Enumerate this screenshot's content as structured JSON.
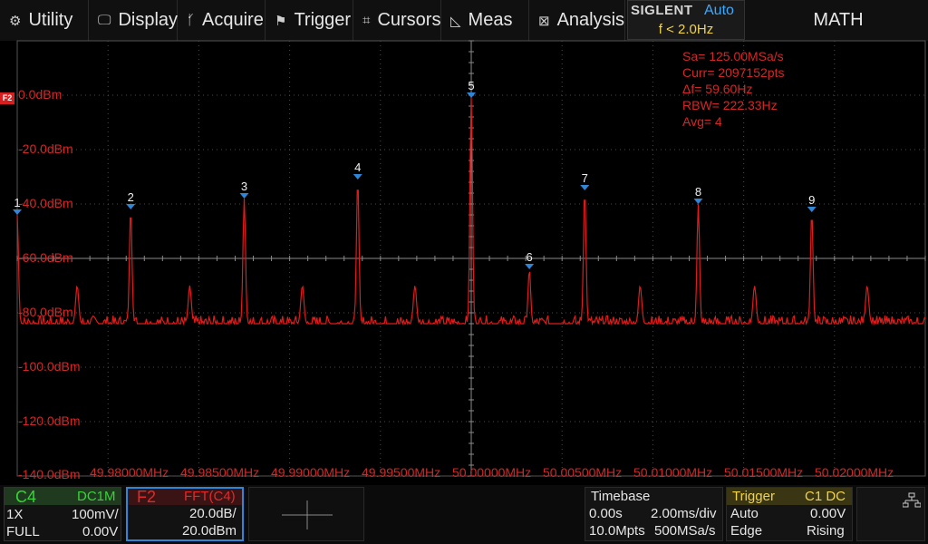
{
  "menu": {
    "utility": {
      "label": "Utility",
      "icon": "gear-icon"
    },
    "display": {
      "label": "Display",
      "icon": "monitor-icon"
    },
    "acquire": {
      "label": "Acquire",
      "icon": "acquire-icon"
    },
    "trigger": {
      "label": "Trigger",
      "icon": "flag-icon"
    },
    "cursors": {
      "label": "Cursors",
      "icon": "crosshair-icon"
    },
    "meas": {
      "label": "Meas",
      "icon": "ruler-icon"
    },
    "analysis": {
      "label": "Analysis",
      "icon": "analysis-icon"
    }
  },
  "brand": {
    "name": "SIGLENT",
    "mode": "Auto",
    "freq": "f < 2.0Hz"
  },
  "math_label": "MATH",
  "trace": {
    "marker": "F2",
    "color": "#e01b1b"
  },
  "y_labels": [
    "0.0dBm",
    "-20.0dBm",
    "-40.0dBm",
    "-60.0dBm",
    "-80.0dBm",
    "-100.0dBm",
    "-120.0dBm",
    "-140.0dBm"
  ],
  "x_labels": [
    "49.98000MHz",
    "49.98500MHz",
    "49.99000MHz",
    "49.99500MHz",
    "50.00000MHz",
    "50.00500MHz",
    "50.01000MHz",
    "50.01500MHz",
    "50.02000MHz"
  ],
  "fft_info": [
    "Sa=  125.00MSa/s",
    "Curr= 2097152pts",
    "Δf=  59.60Hz",
    "RBW=  222.33Hz",
    "Avg= 4"
  ],
  "peaks": [
    {
      "label": "1",
      "freq_mhz": 49.975,
      "dbm": -44
    },
    {
      "label": "2",
      "freq_mhz": 49.98125,
      "dbm": -42
    },
    {
      "label": "3",
      "freq_mhz": 49.9875,
      "dbm": -38
    },
    {
      "label": "4",
      "freq_mhz": 49.99375,
      "dbm": -31
    },
    {
      "label": "5",
      "freq_mhz": 50.0,
      "dbm": -1
    },
    {
      "label": "6",
      "freq_mhz": 50.0032,
      "dbm": -64
    },
    {
      "label": "7",
      "freq_mhz": 50.00625,
      "dbm": -35
    },
    {
      "label": "8",
      "freq_mhz": 50.0125,
      "dbm": -40
    },
    {
      "label": "9",
      "freq_mhz": 50.01875,
      "dbm": -43
    }
  ],
  "c4": {
    "name": "C4",
    "coupling": "DC1M",
    "probe": "1X",
    "scale": "100mV/",
    "bw": "FULL",
    "offset": "0.00V"
  },
  "f2": {
    "name": "F2",
    "source": "FFT(C4)",
    "scale": "20.0dB/",
    "offset": "20.0dBm"
  },
  "timebase": {
    "title": "Timebase",
    "delay": "0.00s",
    "scale": "2.00ms/div",
    "depth": "10.0Mpts",
    "rate": "500MSa/s"
  },
  "trigger": {
    "title": "Trigger",
    "source": "C1 DC",
    "mode": "Auto",
    "level": "0.00V",
    "type": "Edge",
    "slope": "Rising"
  }
}
